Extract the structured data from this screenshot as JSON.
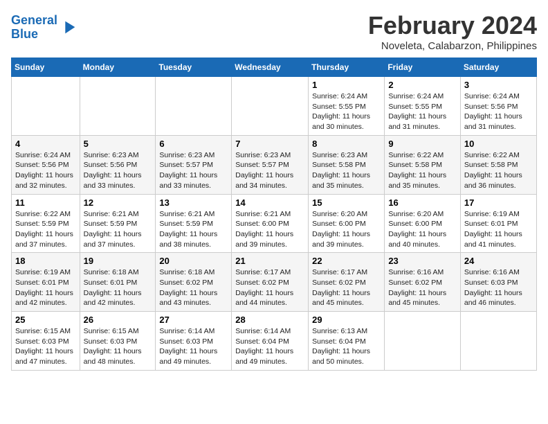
{
  "header": {
    "logo_line1": "General",
    "logo_line2": "Blue",
    "month": "February 2024",
    "location": "Noveleta, Calabarzon, Philippines"
  },
  "days_of_week": [
    "Sunday",
    "Monday",
    "Tuesday",
    "Wednesday",
    "Thursday",
    "Friday",
    "Saturday"
  ],
  "weeks": [
    [
      {
        "num": "",
        "info": ""
      },
      {
        "num": "",
        "info": ""
      },
      {
        "num": "",
        "info": ""
      },
      {
        "num": "",
        "info": ""
      },
      {
        "num": "1",
        "info": "Sunrise: 6:24 AM\nSunset: 5:55 PM\nDaylight: 11 hours and 30 minutes."
      },
      {
        "num": "2",
        "info": "Sunrise: 6:24 AM\nSunset: 5:55 PM\nDaylight: 11 hours and 31 minutes."
      },
      {
        "num": "3",
        "info": "Sunrise: 6:24 AM\nSunset: 5:56 PM\nDaylight: 11 hours and 31 minutes."
      }
    ],
    [
      {
        "num": "4",
        "info": "Sunrise: 6:24 AM\nSunset: 5:56 PM\nDaylight: 11 hours and 32 minutes."
      },
      {
        "num": "5",
        "info": "Sunrise: 6:23 AM\nSunset: 5:56 PM\nDaylight: 11 hours and 33 minutes."
      },
      {
        "num": "6",
        "info": "Sunrise: 6:23 AM\nSunset: 5:57 PM\nDaylight: 11 hours and 33 minutes."
      },
      {
        "num": "7",
        "info": "Sunrise: 6:23 AM\nSunset: 5:57 PM\nDaylight: 11 hours and 34 minutes."
      },
      {
        "num": "8",
        "info": "Sunrise: 6:23 AM\nSunset: 5:58 PM\nDaylight: 11 hours and 35 minutes."
      },
      {
        "num": "9",
        "info": "Sunrise: 6:22 AM\nSunset: 5:58 PM\nDaylight: 11 hours and 35 minutes."
      },
      {
        "num": "10",
        "info": "Sunrise: 6:22 AM\nSunset: 5:58 PM\nDaylight: 11 hours and 36 minutes."
      }
    ],
    [
      {
        "num": "11",
        "info": "Sunrise: 6:22 AM\nSunset: 5:59 PM\nDaylight: 11 hours and 37 minutes."
      },
      {
        "num": "12",
        "info": "Sunrise: 6:21 AM\nSunset: 5:59 PM\nDaylight: 11 hours and 37 minutes."
      },
      {
        "num": "13",
        "info": "Sunrise: 6:21 AM\nSunset: 5:59 PM\nDaylight: 11 hours and 38 minutes."
      },
      {
        "num": "14",
        "info": "Sunrise: 6:21 AM\nSunset: 6:00 PM\nDaylight: 11 hours and 39 minutes."
      },
      {
        "num": "15",
        "info": "Sunrise: 6:20 AM\nSunset: 6:00 PM\nDaylight: 11 hours and 39 minutes."
      },
      {
        "num": "16",
        "info": "Sunrise: 6:20 AM\nSunset: 6:00 PM\nDaylight: 11 hours and 40 minutes."
      },
      {
        "num": "17",
        "info": "Sunrise: 6:19 AM\nSunset: 6:01 PM\nDaylight: 11 hours and 41 minutes."
      }
    ],
    [
      {
        "num": "18",
        "info": "Sunrise: 6:19 AM\nSunset: 6:01 PM\nDaylight: 11 hours and 42 minutes."
      },
      {
        "num": "19",
        "info": "Sunrise: 6:18 AM\nSunset: 6:01 PM\nDaylight: 11 hours and 42 minutes."
      },
      {
        "num": "20",
        "info": "Sunrise: 6:18 AM\nSunset: 6:02 PM\nDaylight: 11 hours and 43 minutes."
      },
      {
        "num": "21",
        "info": "Sunrise: 6:17 AM\nSunset: 6:02 PM\nDaylight: 11 hours and 44 minutes."
      },
      {
        "num": "22",
        "info": "Sunrise: 6:17 AM\nSunset: 6:02 PM\nDaylight: 11 hours and 45 minutes."
      },
      {
        "num": "23",
        "info": "Sunrise: 6:16 AM\nSunset: 6:02 PM\nDaylight: 11 hours and 45 minutes."
      },
      {
        "num": "24",
        "info": "Sunrise: 6:16 AM\nSunset: 6:03 PM\nDaylight: 11 hours and 46 minutes."
      }
    ],
    [
      {
        "num": "25",
        "info": "Sunrise: 6:15 AM\nSunset: 6:03 PM\nDaylight: 11 hours and 47 minutes."
      },
      {
        "num": "26",
        "info": "Sunrise: 6:15 AM\nSunset: 6:03 PM\nDaylight: 11 hours and 48 minutes."
      },
      {
        "num": "27",
        "info": "Sunrise: 6:14 AM\nSunset: 6:03 PM\nDaylight: 11 hours and 49 minutes."
      },
      {
        "num": "28",
        "info": "Sunrise: 6:14 AM\nSunset: 6:04 PM\nDaylight: 11 hours and 49 minutes."
      },
      {
        "num": "29",
        "info": "Sunrise: 6:13 AM\nSunset: 6:04 PM\nDaylight: 11 hours and 50 minutes."
      },
      {
        "num": "",
        "info": ""
      },
      {
        "num": "",
        "info": ""
      }
    ]
  ]
}
